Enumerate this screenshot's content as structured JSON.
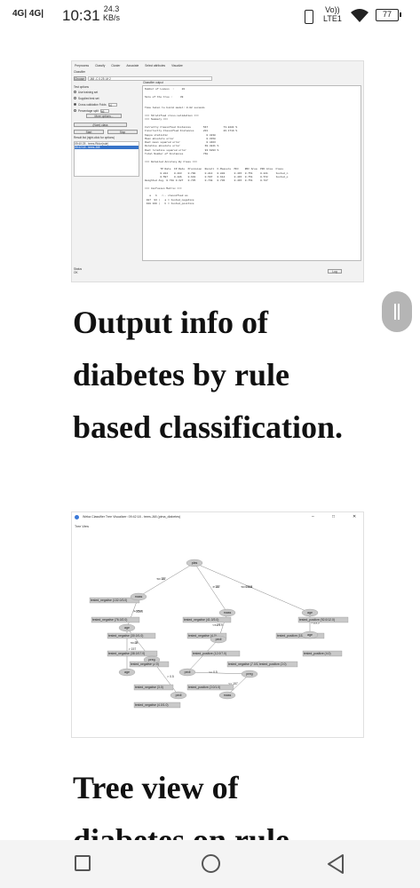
{
  "status_bar": {
    "signal": "4G| 4G|",
    "time": "10:31",
    "speed_value": "24.3",
    "speed_unit": "KB/s",
    "volte_top": "Vo))",
    "volte_bottom": "LTE1",
    "battery": "77"
  },
  "weka_explorer": {
    "tabs": [
      "Preprocess",
      "Classify",
      "Cluster",
      "Associate",
      "Select attributes",
      "Visualize"
    ],
    "classifier_label": "Classifier",
    "choose_label": "Choose",
    "classifier_name": "J48 -C 0.25 -M 2",
    "test_options_label": "Test options",
    "options": [
      {
        "label": "Use training set",
        "selected": false
      },
      {
        "label": "Supplied test set",
        "selected": false
      },
      {
        "label": "Cross-validation  Folds",
        "selected": true,
        "value": "10"
      },
      {
        "label": "Percentage split",
        "selected": false,
        "value": "66"
      }
    ],
    "more_options": "More options...",
    "class_select": "(Nom) class",
    "start": "Start",
    "stop": "Stop",
    "result_list_label": "Result list (right-click for options)",
    "results": [
      {
        "label": "09:40:25 - trees.Ridor(rule)",
        "selected": false
      },
      {
        "label": "09:42:18 - trees.J48",
        "selected": true
      }
    ],
    "output_label": "Classifier output",
    "output_lines": [
      "Number of Leaves  :     20",
      "",
      "Size of the tree :     39",
      "",
      "",
      "Time taken to build model: 0.02 seconds",
      "",
      "=== Stratified cross-validation ===",
      "=== Summary ===",
      "",
      "Correctly Classified Instances        567          73.8281 %",
      "Incorrectly Classified Instances      201          26.1719 %",
      "Kappa statistic                         0.4238",
      "Mean absolute error                     0.3158",
      "Root mean squared error                 0.4463",
      "Relative absolute error                69.4841 %",
      "Root relative squared error            93.6293 %",
      "Total Number of Instances             768",
      "",
      "=== Detailed Accuracy By Class ===",
      "",
      "          TP Rate  FP Rate  Precision  Recall  F-Measure  MCC    ROC Area  PRC Area  Class",
      "          0.814    0.403    0.790      0.814   0.802      0.415  0.751     0.811     tested_n",
      "          0.597    0.186    0.632      0.597   0.614      0.415  0.751     0.572     tested_p",
      "Weighted Avg. 0.738 0.327   0.735      0.738   0.736      0.415  0.751     0.727",
      "",
      "=== Confusion Matrix ===",
      "",
      "   a   b   <-- classified as",
      " 407  93 |   a = tested_negative",
      " 108 160 |   b = tested_positive"
    ],
    "status_label": "Status",
    "status_value": "OK",
    "log_button": "Log"
  },
  "heading_1": "Output info of diabetes by rule based classification.",
  "tree_viewer": {
    "title": "Weka Classifier Tree Visualizer: 09:42:18 - trees.J48 (pima_diabetes)",
    "controls": [
      "–",
      "□",
      "✕"
    ],
    "view_label": "Tree View",
    "nodes": [
      {
        "id": "root",
        "label": "plas",
        "type": "node"
      },
      {
        "id": "n1",
        "label": "mass",
        "type": "node"
      },
      {
        "id": "n2",
        "label": "mass",
        "type": "node"
      },
      {
        "id": "n3",
        "label": "age",
        "type": "node"
      },
      {
        "id": "n4",
        "label": "age",
        "type": "node"
      },
      {
        "id": "n5",
        "label": "pedi",
        "type": "node"
      },
      {
        "id": "n6",
        "label": "age",
        "type": "node"
      },
      {
        "id": "n7",
        "label": "preg",
        "type": "node"
      },
      {
        "id": "n8",
        "label": "pedi",
        "type": "node"
      },
      {
        "id": "n9",
        "label": "preg",
        "type": "node"
      },
      {
        "id": "n10",
        "label": "pedi",
        "type": "node"
      },
      {
        "id": "n11",
        "label": "mass",
        "type": "node"
      },
      {
        "id": "n12",
        "label": "age",
        "type": "node"
      }
    ],
    "leaves": [
      "tested_negative (132.0/3.0)",
      "tested_negative (76.0/2.0)",
      "tested_negative (41.0/3.0)",
      "tested_positive (92.0/12.0)",
      "tested_negative (30.0/1.0)",
      "tested_negative (4.0)",
      "tested_positive (15.0/1.0)",
      "tested_negative (38.0/17.0)",
      "tested_positive (12.0/7.0)",
      "tested_positive (4.0)",
      "tested_negative (2.0)",
      "tested_negative (7.0/1.0)",
      "tested_positive (2.0)",
      "tested_negative (3.0)",
      "tested_positive (2.0/1.0)",
      "tested_negative (4.0/1.0)"
    ],
    "edges": [
      "<= 127",
      "> 127",
      "<= 26.4",
      "> 26.4",
      "<= 29.9",
      "> 29.9",
      "<= 28",
      "> 28",
      "<= 0.5",
      "> 0.5",
      "<= 157",
      "> 157",
      "<= 30",
      "> 30",
      "<= 0.561",
      "> 0.561",
      "<= 7",
      "> 7",
      "<= 2",
      "> 2"
    ]
  },
  "heading_2": "Tree view of diabetes on rule"
}
